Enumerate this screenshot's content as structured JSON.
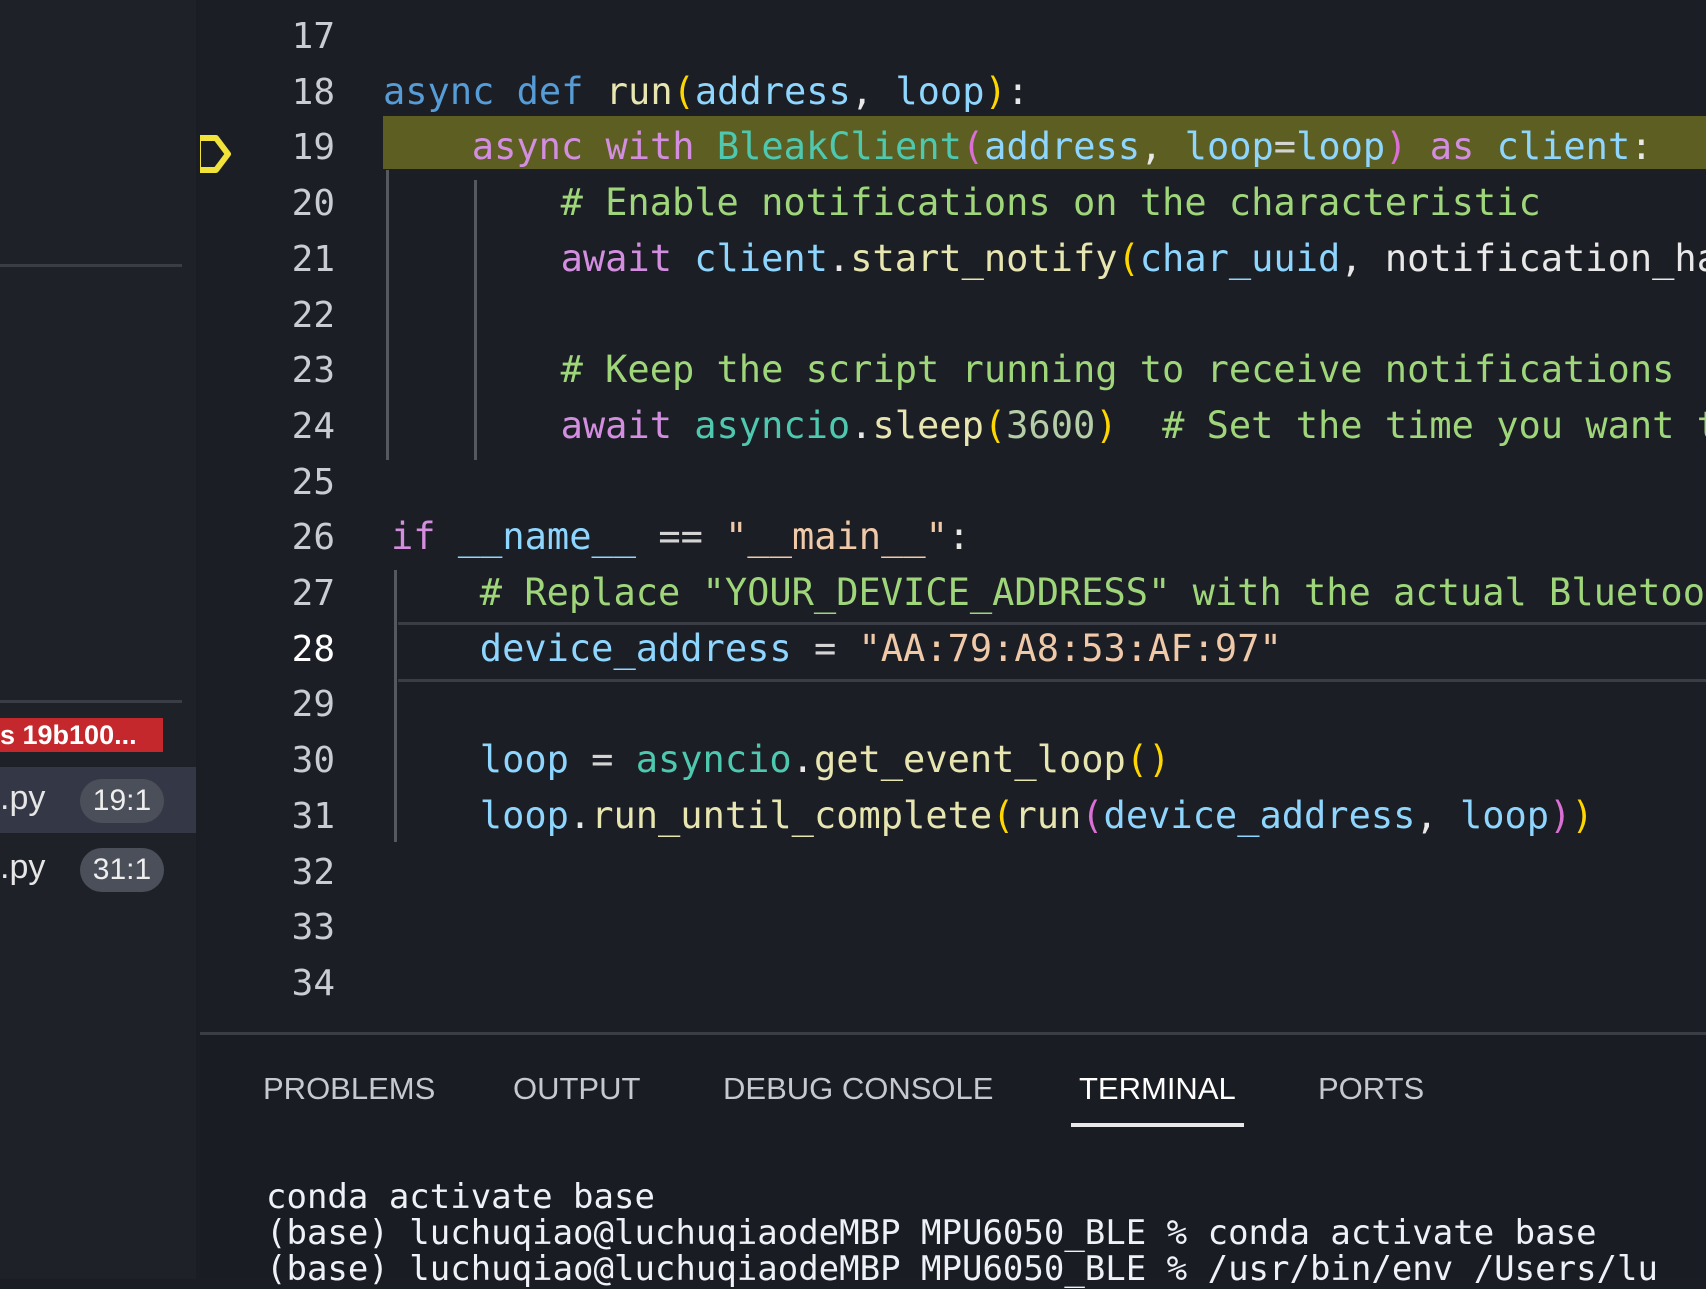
{
  "sidebar": {
    "badge": "s 19b100...",
    "rows": [
      {
        "name": ".py",
        "position": "19:1",
        "active": true
      },
      {
        "name": ".py",
        "position": "31:1",
        "active": false
      }
    ]
  },
  "editor": {
    "breakpoint_line": 19,
    "lines": [
      {
        "n": "17",
        "indent": 0,
        "tokens": []
      },
      {
        "n": "18",
        "indent": 0,
        "tokens": [
          [
            "async ",
            "kw"
          ],
          [
            "def ",
            "kw"
          ],
          [
            "run",
            "fn"
          ],
          [
            "(",
            "br1"
          ],
          [
            "address",
            "var"
          ],
          [
            ", ",
            "pl"
          ],
          [
            "loop",
            "var"
          ],
          [
            ")",
            "br1"
          ],
          [
            ":",
            "pl"
          ]
        ]
      },
      {
        "n": "19",
        "indent": 4,
        "tokens": [
          [
            "async ",
            "kw2"
          ],
          [
            "with ",
            "kw2"
          ],
          [
            "BleakClient",
            "cls"
          ],
          [
            "(",
            "br2"
          ],
          [
            "address",
            "var"
          ],
          [
            ", ",
            "pl"
          ],
          [
            "loop",
            "var"
          ],
          [
            "=",
            "op"
          ],
          [
            "loop",
            "var"
          ],
          [
            ")",
            "br2"
          ],
          [
            " as ",
            "kw2"
          ],
          [
            "client",
            "var"
          ],
          [
            ":",
            "pl"
          ]
        ]
      },
      {
        "n": "20",
        "indent": 8,
        "tokens": [
          [
            "# Enable notifications on the characteristic",
            "cm"
          ]
        ]
      },
      {
        "n": "21",
        "indent": 8,
        "tokens": [
          [
            "await ",
            "kw2"
          ],
          [
            "client",
            "var"
          ],
          [
            ".",
            "pl"
          ],
          [
            "start_notify",
            "fn"
          ],
          [
            "(",
            "br1"
          ],
          [
            "char_uuid",
            "var"
          ],
          [
            ", ",
            "pl"
          ],
          [
            "notification_ha",
            "pl"
          ]
        ]
      },
      {
        "n": "22",
        "indent": 0,
        "tokens": []
      },
      {
        "n": "23",
        "indent": 8,
        "tokens": [
          [
            "# Keep the script running to receive notifications",
            "cm"
          ]
        ]
      },
      {
        "n": "24",
        "indent": 8,
        "tokens": [
          [
            "await ",
            "kw2"
          ],
          [
            "asyncio",
            "cls"
          ],
          [
            ".",
            "pl"
          ],
          [
            "sleep",
            "fn"
          ],
          [
            "(",
            "br1"
          ],
          [
            "3600",
            "num"
          ],
          [
            ")",
            "br1"
          ],
          [
            "  # Set the time you want t",
            "cm"
          ]
        ]
      },
      {
        "n": "25",
        "indent": 0,
        "tokens": []
      },
      {
        "n": "26",
        "indent": 0,
        "tokens": [
          [
            "if ",
            "kw2"
          ],
          [
            "__name__",
            "var"
          ],
          [
            " == ",
            "op"
          ],
          [
            "\"__main__\"",
            "str"
          ],
          [
            ":",
            "pl"
          ]
        ]
      },
      {
        "n": "27",
        "indent": 4,
        "tokens": [
          [
            "# Replace \"YOUR_DEVICE_ADDRESS\" with the actual Bluetoot",
            "cm"
          ]
        ]
      },
      {
        "n": "28",
        "indent": 4,
        "tokens": [
          [
            "device_address",
            "var"
          ],
          [
            " = ",
            "op"
          ],
          [
            "\"AA:79:A8:53:AF:97\"",
            "str"
          ]
        ]
      },
      {
        "n": "29",
        "indent": 0,
        "tokens": []
      },
      {
        "n": "30",
        "indent": 4,
        "tokens": [
          [
            "loop",
            "var"
          ],
          [
            " = ",
            "op"
          ],
          [
            "asyncio",
            "cls"
          ],
          [
            ".",
            "pl"
          ],
          [
            "get_event_loop",
            "fn"
          ],
          [
            "()",
            "br1"
          ]
        ]
      },
      {
        "n": "31",
        "indent": 4,
        "tokens": [
          [
            "loop",
            "var"
          ],
          [
            ".",
            "pl"
          ],
          [
            "run_until_complete",
            "fn"
          ],
          [
            "(",
            "br1"
          ],
          [
            "run",
            "fn"
          ],
          [
            "(",
            "br2"
          ],
          [
            "device_address",
            "var"
          ],
          [
            ", ",
            "pl"
          ],
          [
            "loop",
            "var"
          ],
          [
            ")",
            "br2"
          ],
          [
            ")",
            "br1"
          ]
        ]
      },
      {
        "n": "32",
        "indent": 0,
        "tokens": []
      },
      {
        "n": "33",
        "indent": 0,
        "tokens": []
      },
      {
        "n": "34",
        "indent": 0,
        "tokens": []
      }
    ]
  },
  "panel": {
    "tabs": [
      "PROBLEMS",
      "OUTPUT",
      "DEBUG CONSOLE",
      "TERMINAL",
      "PORTS"
    ],
    "active_tab": "TERMINAL",
    "terminal_lines": [
      "conda activate base",
      "(base) luchuqiao@luchuqiaodeMBP MPU6050_BLE % conda activate base",
      "(base) luchuqiao@luchuqiaodeMBP MPU6050_BLE % /usr/bin/env /Users/lu"
    ]
  },
  "colors": {
    "breakpoint": "#f2e33a",
    "highlight": "#5d5f22",
    "badge": "#c4282d"
  }
}
